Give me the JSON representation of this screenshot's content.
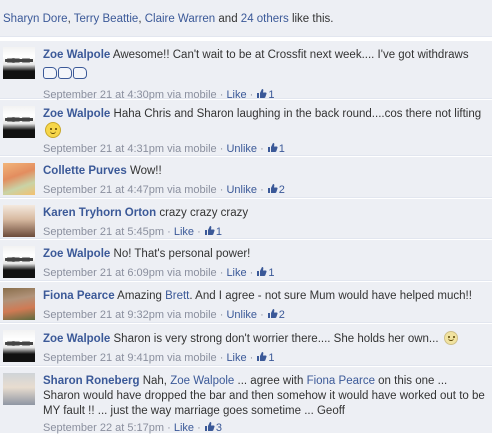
{
  "likes": {
    "names": [
      "Sharyn Dore",
      "Terry Beattie",
      "Claire Warren"
    ],
    "sep1": ", ",
    "sep2": ", ",
    "and_text": " and ",
    "others": "24 others",
    "suffix": " like this."
  },
  "comments": [
    {
      "author": "Zoe Walpole",
      "text": "Awesome!! Can't wait to be at Crossfit next week.... I've got withdraws",
      "time": "September 21 at 4:30pm via mobile",
      "action": "Like",
      "count": "1",
      "avatar": "zoe"
    },
    {
      "author": "Zoe Walpole",
      "text": "Haha Chris and Sharon laughing in the back round....cos there not lifting",
      "time": "September 21 at 4:31pm via mobile",
      "action": "Unlike",
      "count": "1",
      "avatar": "zoe"
    },
    {
      "author": "Collette Purves",
      "text": "Wow!!",
      "time": "September 21 at 4:47pm via mobile",
      "action": "Unlike",
      "count": "2",
      "avatar": "collette"
    },
    {
      "author": "Karen Tryhorn Orton",
      "text": "crazy crazy crazy",
      "time": "September 21 at 5:45pm",
      "action": "Like",
      "count": "1",
      "avatar": "karen"
    },
    {
      "author": "Zoe Walpole",
      "text": "No! That's personal power!",
      "time": "September 21 at 6:09pm via mobile",
      "action": "Like",
      "count": "1",
      "avatar": "zoe"
    },
    {
      "author": "Fiona Pearce",
      "text_before": "Amazing ",
      "text_link": "Brett",
      "text_after": ". And I agree - not sure Mum would have helped much!!",
      "time": "September 21 at 9:32pm via mobile",
      "action": "Unlike",
      "count": "2",
      "avatar": "fiona"
    },
    {
      "author": "Zoe Walpole",
      "text": "Sharon is very strong don't worrier there.... She holds her own...",
      "time": "September 21 at 9:41pm via mobile",
      "action": "Like",
      "count": "1",
      "avatar": "zoe"
    },
    {
      "author": "Sharon Roneberg",
      "text_a": "Nah, ",
      "mention1": "Zoe Walpole",
      "text_b": " ... agree with ",
      "mention2": "Fiona Pearce",
      "text_c": " on this one ... Sharon would have dropped the bar and then somehow it would have worked out to be MY fault !! ... just the way marriage goes sometime ... Geoff",
      "time": "September 22 at 5:17pm",
      "action": "Like",
      "count": "3",
      "avatar": "sharon"
    }
  ],
  "meta_sep": " · ",
  "icons": {
    "thumb": "thumbs-up-icon",
    "smiley": "smiley-icon",
    "fist": "fist-bump-icon"
  },
  "colors": {
    "link": "#3b5998",
    "bg": "#edeff4",
    "meta": "#8a8f9e"
  }
}
